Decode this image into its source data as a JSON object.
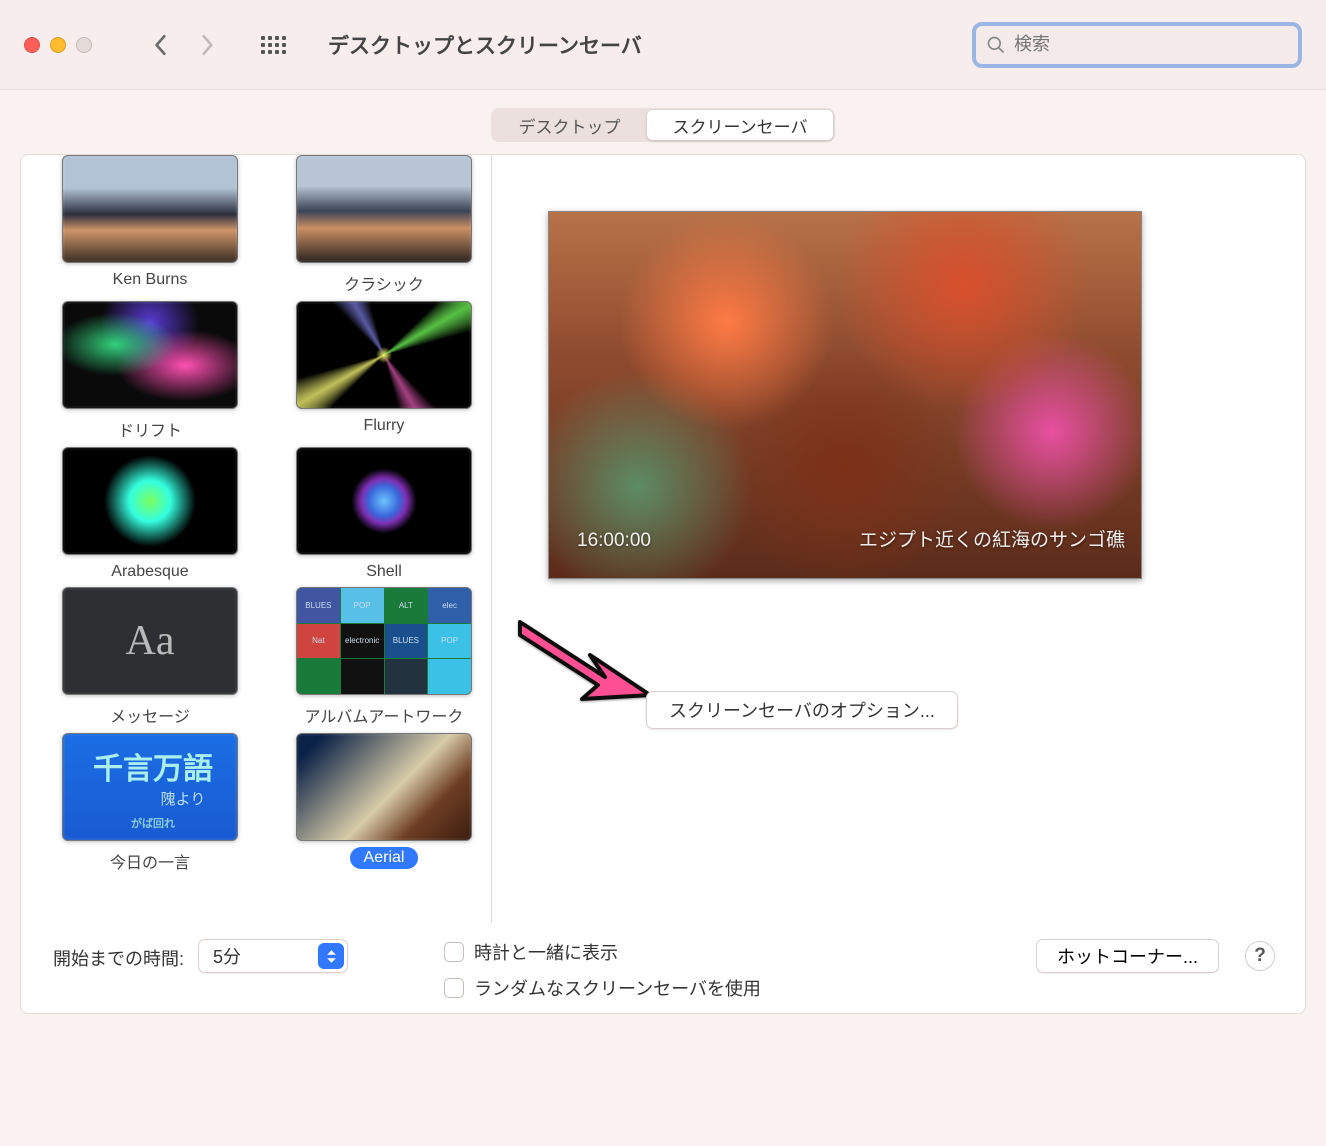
{
  "window": {
    "title": "デスクトップとスクリーンセーバ"
  },
  "search": {
    "placeholder": "検索"
  },
  "tabs": {
    "desktop": "デスクトップ",
    "screensaver": "スクリーンセーバ"
  },
  "screensavers": [
    {
      "id": "ken-burns",
      "label": "Ken Burns"
    },
    {
      "id": "classic",
      "label": "クラシック"
    },
    {
      "id": "drift",
      "label": "ドリフト"
    },
    {
      "id": "flurry",
      "label": "Flurry"
    },
    {
      "id": "arabesque",
      "label": "Arabesque"
    },
    {
      "id": "shell",
      "label": "Shell"
    },
    {
      "id": "message",
      "label": "メッセージ"
    },
    {
      "id": "album-artwork",
      "label": "アルバムアートワーク"
    },
    {
      "id": "word-of-day",
      "label": "今日の一言"
    },
    {
      "id": "aerial",
      "label": "Aerial",
      "selected": true
    }
  ],
  "word_thumb": {
    "big": "千言万語",
    "mid": "隗より",
    "small": "がば回れ"
  },
  "aa_thumb": "Aa",
  "preview": {
    "time": "16:00:00",
    "caption": "エジプト近くの紅海のサンゴ礁"
  },
  "options_button": "スクリーンセーバのオプション...",
  "footer": {
    "start_label": "開始までの時間:",
    "start_value": "5分",
    "show_clock": "時計と一緒に表示",
    "random": "ランダムなスクリーンセーバを使用",
    "hot_corners": "ホットコーナー...",
    "help": "?"
  }
}
